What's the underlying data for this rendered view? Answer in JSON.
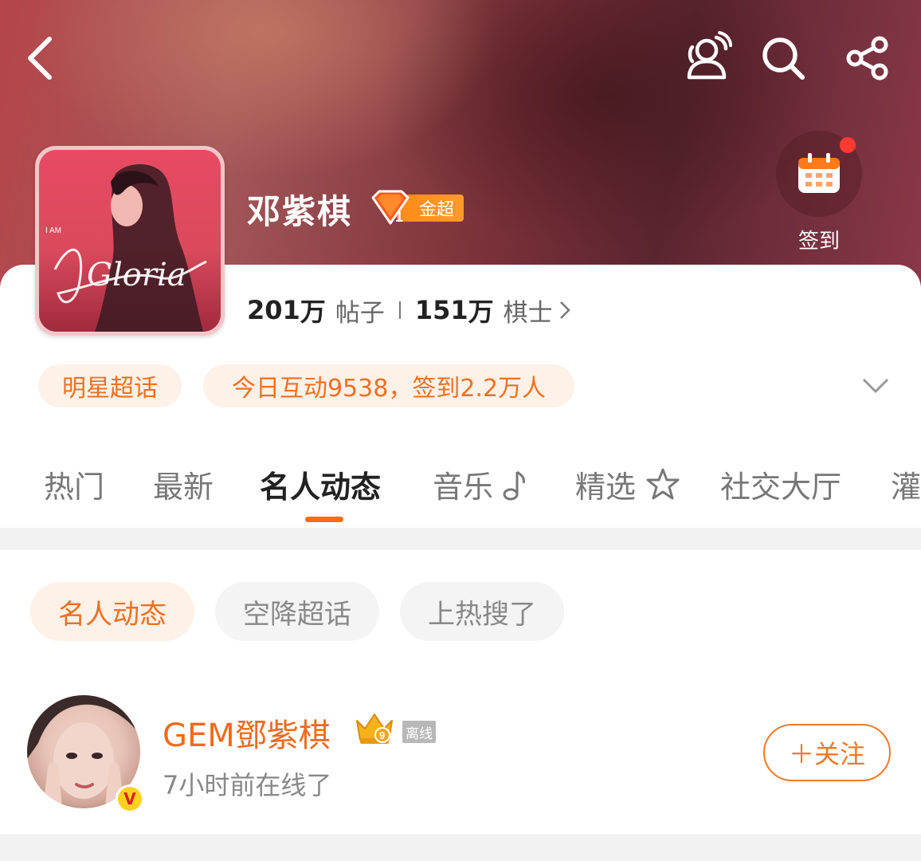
{
  "header": {
    "title": "邓紫棋",
    "badge_label": "金超",
    "badge_level": "1",
    "signin_label": "签到",
    "icons": [
      "back-icon",
      "people-icon",
      "search-icon",
      "share-icon"
    ]
  },
  "cover": {
    "text_top": "I AM",
    "text_script": "Gloria"
  },
  "stats": {
    "posts_count": "201",
    "posts_unit": "万",
    "posts_label": "帖子",
    "members_count": "151",
    "members_unit": "万",
    "members_label": "棋士"
  },
  "tags": {
    "category": "明星超话",
    "interaction": "今日互动9538，签到2.2万人"
  },
  "tabs": [
    {
      "label": "热门"
    },
    {
      "label": "最新"
    },
    {
      "label": "名人动态"
    },
    {
      "label": "音乐"
    },
    {
      "label": "精选"
    },
    {
      "label": "社交大厅"
    },
    {
      "label": "灌"
    }
  ],
  "active_tab": "名人动态",
  "chips": [
    {
      "label": "名人动态"
    },
    {
      "label": "空降超话"
    },
    {
      "label": "上热搜了"
    }
  ],
  "user": {
    "name": "GEM鄧紫棋",
    "crown_level": "9",
    "status_tag": "离线",
    "last_online": "7小时前在线了",
    "follow_label": "＋关注",
    "verified_mark": "V"
  },
  "colors": {
    "accent": "#f07020",
    "tab_underline": "#ff6a1a",
    "badge_orange": "#ff8a1a"
  }
}
